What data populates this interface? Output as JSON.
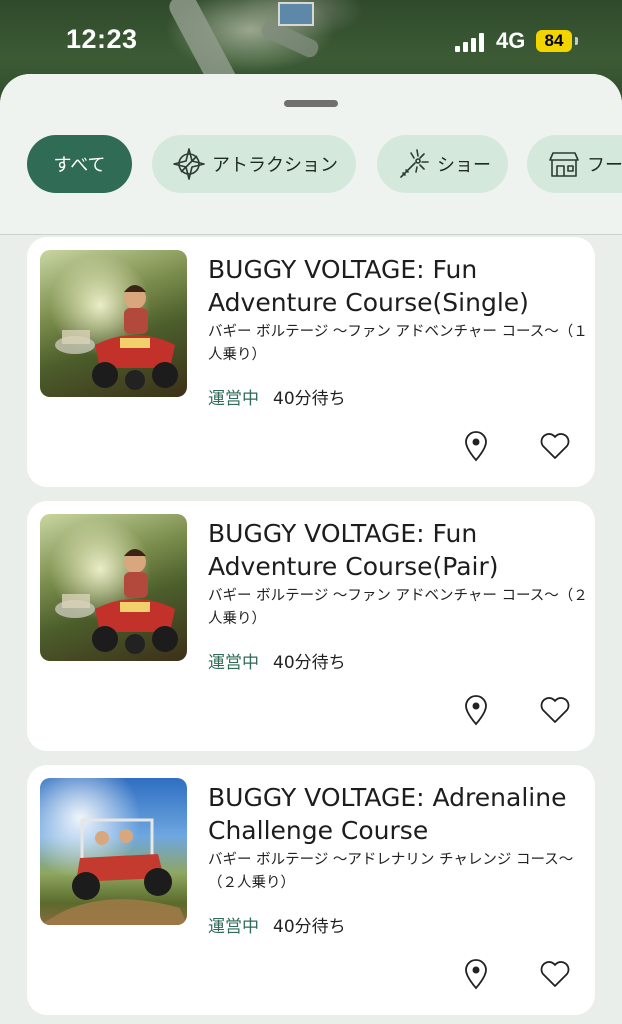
{
  "status_bar": {
    "time": "12:23",
    "network": "4G",
    "battery": "84"
  },
  "filters": [
    {
      "label": "すべて",
      "icon": "",
      "active": true
    },
    {
      "label": "アトラクション",
      "icon": "compass-icon",
      "active": false
    },
    {
      "label": "ショー",
      "icon": "magic-wand-icon",
      "active": false
    },
    {
      "label": "フー",
      "icon": "shop-icon",
      "active": false
    }
  ],
  "cards": [
    {
      "title": "BUGGY VOLTAGE: Fun Adventure Course(Single)",
      "subtitle": "バギー ボルテージ 〜ファン アドベンチャー コース〜（１人乗り）",
      "status": "運営中",
      "wait": "40分待ち",
      "image": "forest-buggy-image"
    },
    {
      "title": "BUGGY VOLTAGE: Fun Adventure Course(Pair)",
      "subtitle": "バギー ボルテージ 〜ファン アドベンチャー コース〜（２人乗り）",
      "status": "運営中",
      "wait": "40分待ち",
      "image": "forest-buggy-image"
    },
    {
      "title": "BUGGY VOLTAGE: Adrenaline Challenge Course",
      "subtitle": "バギー ボルテージ 〜アドレナリン チャレンジ コース〜（２人乗り）",
      "status": "運営中",
      "wait": "40分待ち",
      "image": "sky-buggy-image"
    }
  ],
  "colors": {
    "accent": "#2f6b55",
    "chip": "#d4e9dc",
    "background": "#e9eeea"
  }
}
